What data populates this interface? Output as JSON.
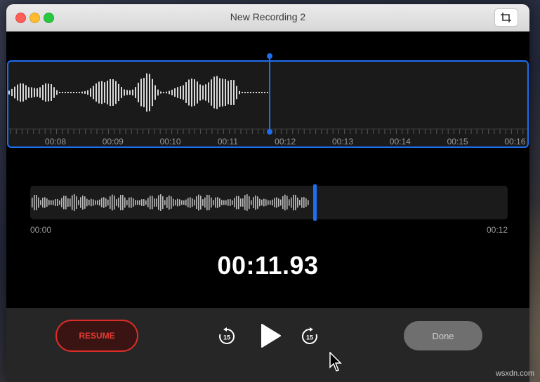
{
  "window": {
    "title": "New Recording 2",
    "icons": [
      "close-button",
      "minimize-button",
      "zoom-button",
      "trim-icon"
    ]
  },
  "detail_waveform": {
    "time_labels": [
      "00:08",
      "00:09",
      "00:10",
      "00:11",
      "00:12",
      "00:13",
      "00:14",
      "00:15",
      "00:16"
    ],
    "accent_color": "#1e6ff0"
  },
  "overview_waveform": {
    "start_label": "00:00",
    "end_label": "00:12",
    "playhead_fraction": 0.59
  },
  "timer": {
    "elapsed": "00:11.93"
  },
  "controls": {
    "resume_label": "RESUME",
    "done_label": "Done",
    "skip_back_seconds": "15",
    "skip_forward_seconds": "15",
    "resume_color": "#d92d28"
  },
  "watermark": "wsxdn.com"
}
